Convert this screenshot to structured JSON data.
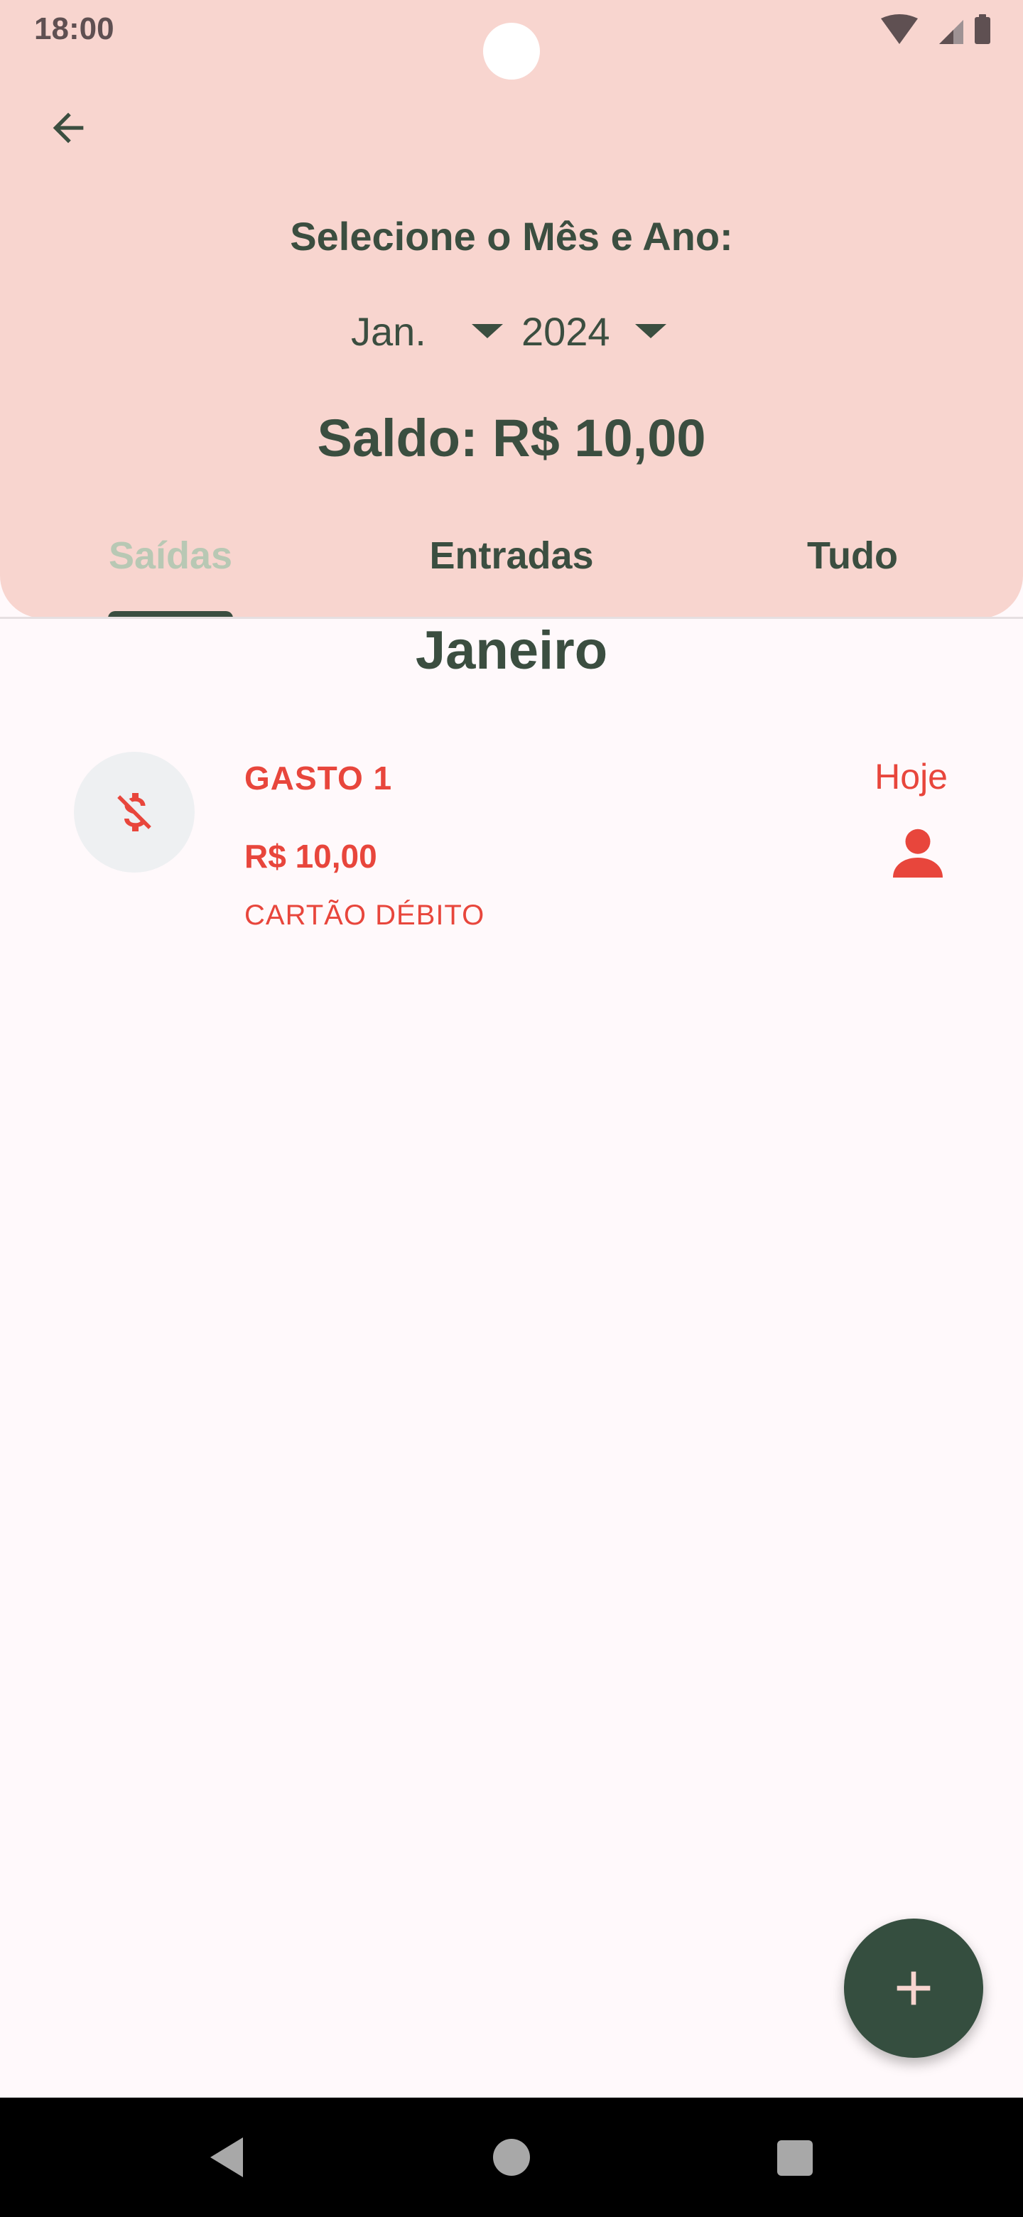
{
  "status_bar": {
    "time": "18:00"
  },
  "header": {
    "back_icon": "arrow-back-icon",
    "picker_title": "Selecione o Mês e Ano:",
    "month_value": "Jan.",
    "year_value": "2024",
    "balance": "Saldo: R$ 10,00"
  },
  "tabs": [
    {
      "label": "Saídas",
      "selected": true
    },
    {
      "label": "Entradas",
      "selected": false
    },
    {
      "label": "Tudo",
      "selected": false
    }
  ],
  "content": {
    "month_heading": "Janeiro",
    "transactions": [
      {
        "icon": "money-off-icon",
        "name": "GASTO 1",
        "amount": "R$ 10,00",
        "method": "CARTÃO DÉBITO",
        "date": "Hoje",
        "owner_icon": "person-icon"
      }
    ]
  },
  "fab": {
    "icon": "add-icon"
  },
  "colors": {
    "header_bg": "#f8d5cf",
    "primary_dark_green": "#3b4e40",
    "expense_red": "#e8463c",
    "tab_inactive": "#b8c8b4",
    "fab_bg": "#354e3f",
    "page_bg": "#fff9fb"
  }
}
